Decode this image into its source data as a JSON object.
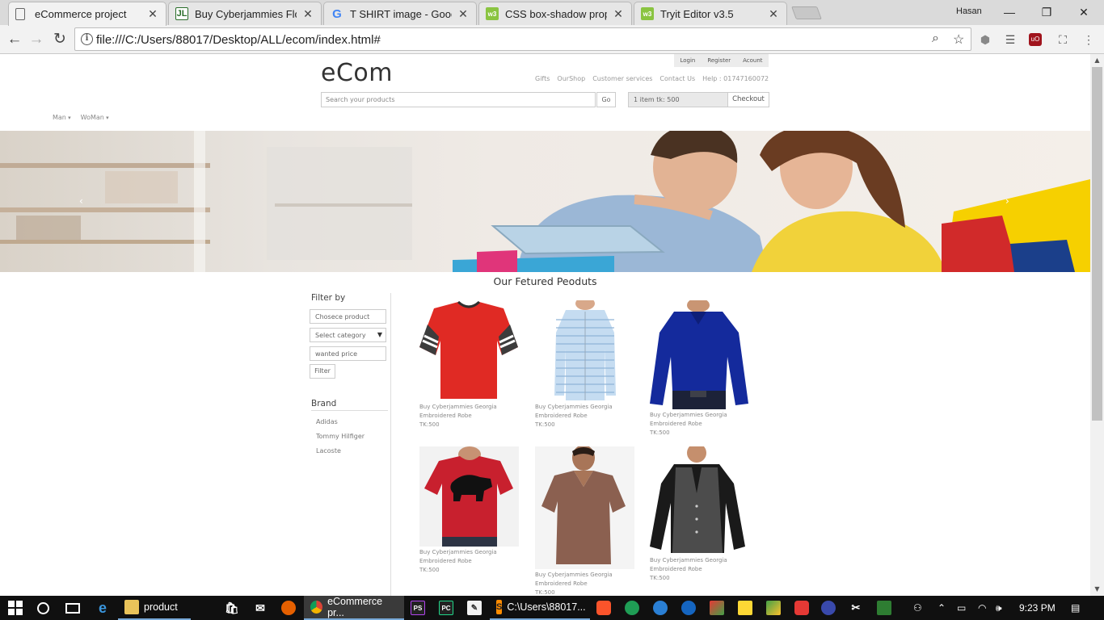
{
  "browser": {
    "tabs": [
      {
        "title": "eCommerce project",
        "favicon": "page-icon",
        "active": true
      },
      {
        "title": "Buy Cyberjammies Floren",
        "favicon": "jl-icon",
        "active": false
      },
      {
        "title": "T SHIRT image - Google",
        "favicon": "google-icon",
        "active": false
      },
      {
        "title": "CSS box-shadow propert",
        "favicon": "w3-icon",
        "active": false
      },
      {
        "title": "Tryit Editor v3.5",
        "favicon": "w3-icon",
        "active": false
      }
    ],
    "window_user": "Hasan",
    "url": "file:///C:/Users/88017/Desktop/ALL/ecom/index.html#"
  },
  "page": {
    "top_links": [
      "Login",
      "Register",
      "Acount"
    ],
    "logo": "eCom",
    "main_nav": [
      "Gifts",
      "OurShop",
      "Customer services",
      "Contact Us",
      "Help : 01747160072"
    ],
    "search_placeholder": "Search your products",
    "go_label": "Go",
    "cart_info": "1 item tk: 500",
    "checkout_label": "Checkout",
    "category_nav": [
      "Man",
      "WoMan"
    ],
    "section_title": "Our Fetured Peoduts",
    "filter": {
      "heading": "Filter by",
      "product_placeholder": "Chosece product",
      "category_select": "Select category",
      "price_placeholder": "wanted price",
      "button": "Filter"
    },
    "brand": {
      "heading": "Brand",
      "items": [
        "Adidas",
        "Tommy Hilfiger",
        "Lacoste"
      ]
    },
    "products": [
      {
        "name": "Buy Cyberjammies Georgia Embroidered Robe",
        "price": "TK:500",
        "image": "red-tshirt-striped-sleeves"
      },
      {
        "name": "Buy Cyberjammies Georgia Embroidered Robe",
        "price": "TK:500",
        "image": "light-blue-striped-shirt"
      },
      {
        "name": "Buy Cyberjammies Georgia Embroidered Robe",
        "price": "TK:500",
        "image": "navy-blue-dress-shirt"
      },
      {
        "name": "Buy Cyberjammies Georgia Embroidered Robe",
        "price": "TK:500",
        "image": "red-tshirt-bear-print"
      },
      {
        "name": "Buy Cyberjammies Georgia Embroidered Robe",
        "price": "TK:500",
        "image": "brown-vneck-tshirt"
      },
      {
        "name": "Buy Cyberjammies Georgia Embroidered Robe",
        "price": "TK:500",
        "image": "grey-vest-black-shirt"
      }
    ]
  },
  "taskbar": {
    "apps": [
      {
        "label": "product",
        "icon": "folder-icon"
      },
      {
        "label": "eCommerce pr...",
        "icon": "chrome-icon"
      },
      {
        "label": "C:\\Users\\88017...",
        "icon": "sublime-icon"
      }
    ],
    "clock": "9:23 PM"
  }
}
